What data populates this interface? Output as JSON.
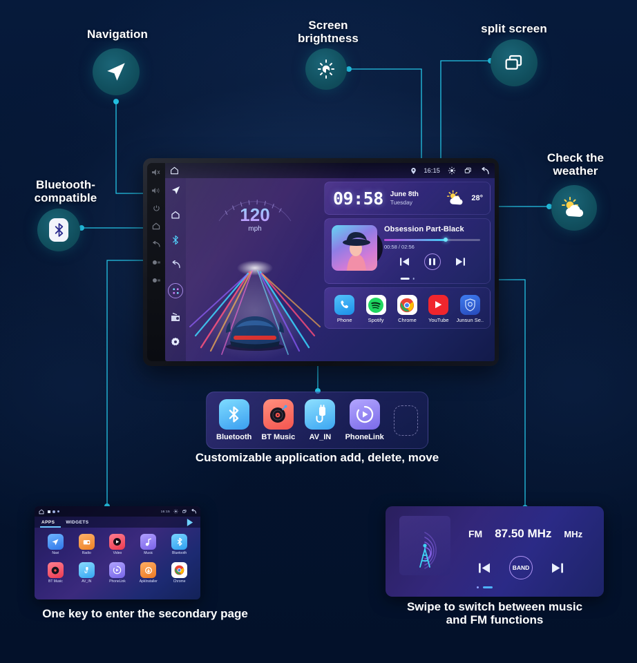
{
  "annotations": [
    {
      "id": "navigation",
      "label": "Navigation",
      "icon": "navigation-arrow-icon"
    },
    {
      "id": "brightness",
      "label": "Screen\nbrightness",
      "icon": "brightness-icon"
    },
    {
      "id": "splitscreen",
      "label": "split screen",
      "icon": "split-screen-icon"
    },
    {
      "id": "bluetooth",
      "label": "Bluetooth-\ncompatible",
      "icon": "bluetooth-icon"
    },
    {
      "id": "weather",
      "label": "Check the\nweather",
      "icon": "weather-sun-cloud-icon"
    }
  ],
  "captions": {
    "tray": "Customizable application add, delete, move",
    "secondary_page": "One key to enter the secondary page",
    "fm": "Swipe to switch between music\nand FM functions"
  },
  "head_unit": {
    "status_bar": {
      "home_icon": "home-icon",
      "location_icon": "location-pin-icon",
      "time": "16:15",
      "brightness_icon": "brightness-icon",
      "split_icon": "split-screen-icon",
      "back_icon": "back-arrow-icon"
    },
    "sidebar": [
      {
        "name": "navigation",
        "icon": "navigation-arrow-icon"
      },
      {
        "name": "home",
        "icon": "home-pentagon-icon"
      },
      {
        "name": "bluetooth",
        "icon": "bluetooth-icon"
      },
      {
        "name": "back",
        "icon": "back-arrow-icon"
      },
      {
        "name": "apps",
        "icon": "apps-grid-icon"
      },
      {
        "name": "radio",
        "icon": "radio-icon"
      },
      {
        "name": "settings",
        "icon": "settings-gear-icon"
      }
    ],
    "speedometer": {
      "value": "120",
      "unit": "mph"
    },
    "clock_widget": {
      "time": "09:58",
      "date": "June 8th",
      "weekday": "Tuesday",
      "temperature": "28°",
      "weather_icon": "sun-cloud-icon"
    },
    "music_widget": {
      "title": "Obsession Part-Black",
      "elapsed_total": "00:58 / 02:56",
      "progress_percent": 64,
      "prev_icon": "skip-previous-icon",
      "play_icon": "pause-icon",
      "next_icon": "skip-next-icon"
    },
    "dock": [
      {
        "label": "Phone",
        "icon": "phone-icon",
        "color": "#34a9f2"
      },
      {
        "label": "Spotify",
        "icon": "spotify-icon",
        "color": "#19d25f"
      },
      {
        "label": "Chrome",
        "icon": "chrome-icon",
        "color": "#ffffff"
      },
      {
        "label": "YouTube",
        "icon": "youtube-icon",
        "color": "#f0262d"
      },
      {
        "label": "Junsun Se..",
        "icon": "junsun-icon",
        "color": "#2f63d8"
      }
    ]
  },
  "tray_apps": [
    {
      "label": "Bluetooth",
      "icon": "bluetooth-icon",
      "color": "#4db6f5"
    },
    {
      "label": "BT Music",
      "icon": "vinyl-icon",
      "color": "#ff6b63"
    },
    {
      "label": "AV_IN",
      "icon": "av-cable-icon",
      "color": "#58c6f7"
    },
    {
      "label": "PhoneLink",
      "icon": "phonelink-icon",
      "color": "#8f84ef"
    }
  ],
  "secondary_page": {
    "tabs": [
      "APPS",
      "WIDGETS"
    ],
    "active_tab": "APPS",
    "status_time": "16:15",
    "apps": [
      {
        "label": "Navi",
        "color": "#3d8bf5"
      },
      {
        "label": "Radio",
        "color": "#f09336"
      },
      {
        "label": "Video",
        "color": "#f2515f"
      },
      {
        "label": "Music",
        "color": "#8e78ef"
      },
      {
        "label": "Bluetooth",
        "color": "#47b6f2"
      },
      {
        "label": "BT Music",
        "color": "#f2505e"
      },
      {
        "label": "AV_IN",
        "color": "#4fb9f5"
      },
      {
        "label": "PhoneLink",
        "color": "#8a7bef"
      },
      {
        "label": "ApkInstaller",
        "color": "#f08a3a"
      },
      {
        "label": "Chrome",
        "color": "#ffffff"
      }
    ]
  },
  "fm_page": {
    "band": "FM",
    "frequency": "87.50 MHz",
    "unit": "MHz",
    "band_button": "BAND",
    "prev_icon": "skip-previous-icon",
    "next_icon": "skip-next-icon",
    "antenna_icon": "radio-tower-icon"
  },
  "colors": {
    "background": "#04142f",
    "accent_line": "#25c6e8",
    "badge_teal": "#11505f",
    "text": "#ffffff"
  }
}
